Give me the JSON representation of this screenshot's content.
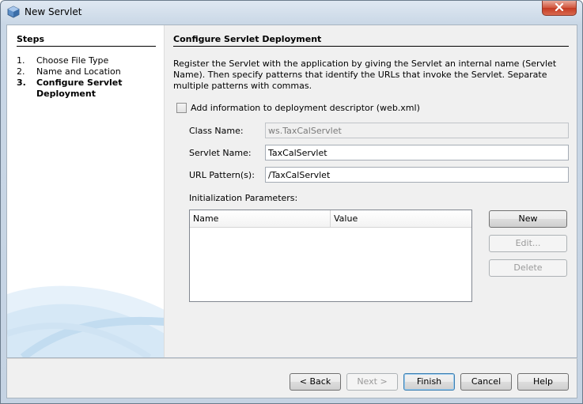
{
  "window": {
    "title": "New Servlet",
    "icons": {
      "app": "netbeans-cube-icon",
      "close": "close-icon"
    }
  },
  "steps": {
    "title": "Steps",
    "items": [
      {
        "num": "1.",
        "label": "Choose File Type",
        "current": false
      },
      {
        "num": "2.",
        "label": "Name and Location",
        "current": false
      },
      {
        "num": "3.",
        "label": "Configure Servlet Deployment",
        "current": true
      }
    ]
  },
  "panel": {
    "title": "Configure Servlet Deployment",
    "description": "Register the Servlet with the application by giving the Servlet an internal name (Servlet Name). Then specify patterns that identify the URLs that invoke the Servlet. Separate multiple patterns with commas.",
    "checkbox": {
      "label": "Add information to deployment descriptor (web.xml)",
      "checked": false
    },
    "fields": {
      "class_name": {
        "label": "Class Name:",
        "value": "ws.TaxCalServlet",
        "enabled": false
      },
      "servlet_name": {
        "label": "Servlet Name:",
        "value": "TaxCalServlet",
        "enabled": true
      },
      "url_pattern": {
        "label": "URL Pattern(s):",
        "value": "/TaxCalServlet",
        "enabled": true
      }
    },
    "init_params": {
      "label": "Initialization Parameters:",
      "columns": [
        "Name",
        "Value"
      ],
      "rows": []
    },
    "side_buttons": {
      "new": {
        "label": "New",
        "enabled": true
      },
      "edit": {
        "label": "Edit...",
        "enabled": false
      },
      "delete": {
        "label": "Delete",
        "enabled": false
      }
    }
  },
  "footer": {
    "back": "< Back",
    "next": "Next >",
    "finish": "Finish",
    "cancel": "Cancel",
    "help": "Help"
  },
  "colors": {
    "title_bar": "#c9d7e6",
    "close_button": "#c43a22",
    "panel_bg": "#f0f0f0",
    "default_button_border": "#3c7fb1"
  }
}
